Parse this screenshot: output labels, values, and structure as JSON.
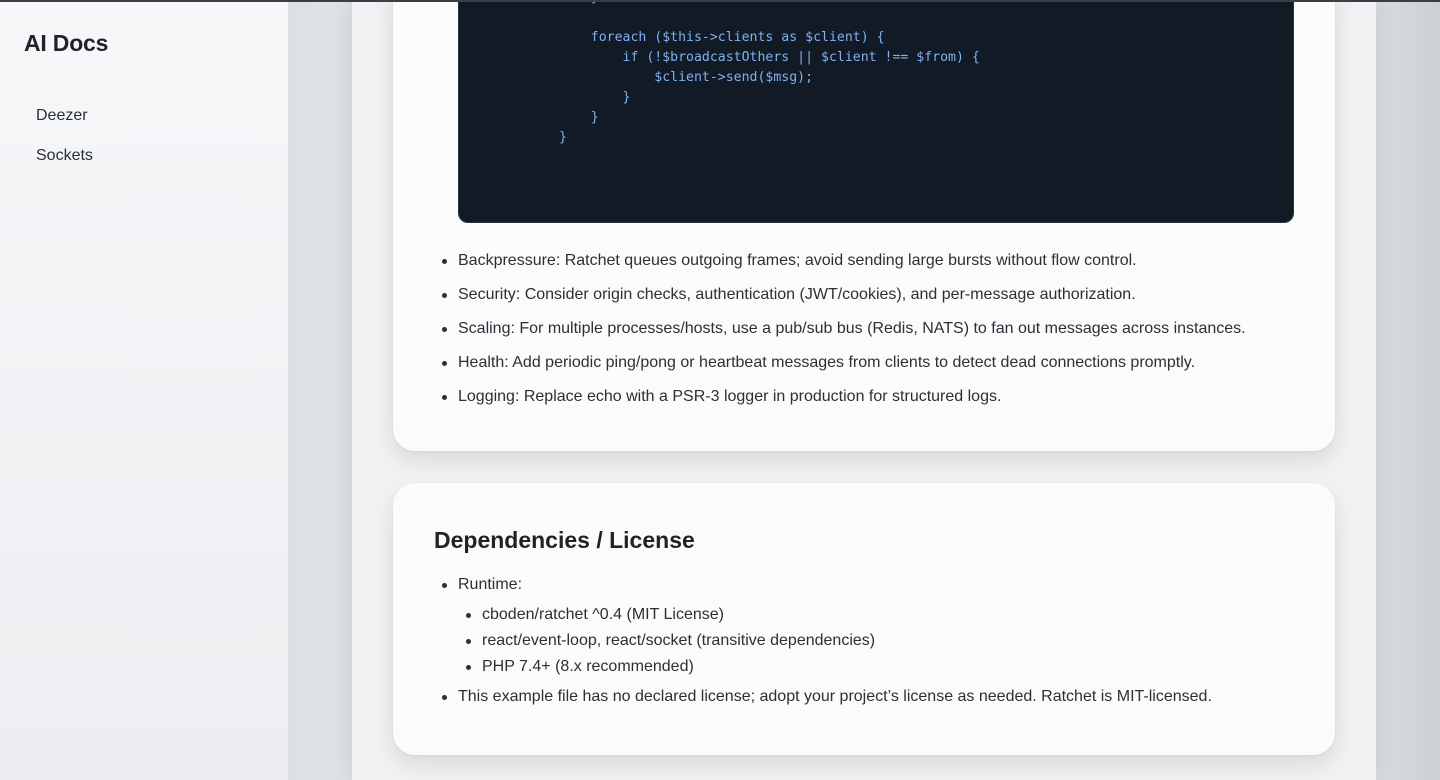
{
  "sidebar": {
    "brand": "AI Docs",
    "items": [
      {
        "label": "Deezer"
      },
      {
        "label": "Sockets"
      }
    ]
  },
  "code_block": {
    "lines": [
      "    }",
      "",
      "    foreach ($this->clients as $client) {",
      "        if (!$broadcastOthers || $client !== $from) {",
      "            $client->send($msg);",
      "        }",
      "    }",
      "}"
    ]
  },
  "notes": {
    "items": [
      "Backpressure: Ratchet queues outgoing frames; avoid sending large bursts without flow control.",
      "Security: Consider origin checks, authentication (JWT/cookies), and per-message authorization.",
      "Scaling: For multiple processes/hosts, use a pub/sub bus (Redis, NATS) to fan out messages across instances.",
      "Health: Add periodic ping/pong or heartbeat messages from clients to detect dead connections promptly.",
      "Logging: Replace echo with a PSR-3 logger in production for structured logs."
    ]
  },
  "dependencies": {
    "title": "Dependencies / License",
    "runtime_label": "Runtime:",
    "runtime_items": [
      "cboden/ratchet ^0.4 (MIT License)",
      "react/event-loop, react/socket (transitive dependencies)",
      "PHP 7.4+ (8.x recommended)"
    ],
    "license_note": "This example file has no declared license; adopt your project’s license as needed. Ratchet is MIT-licensed."
  }
}
